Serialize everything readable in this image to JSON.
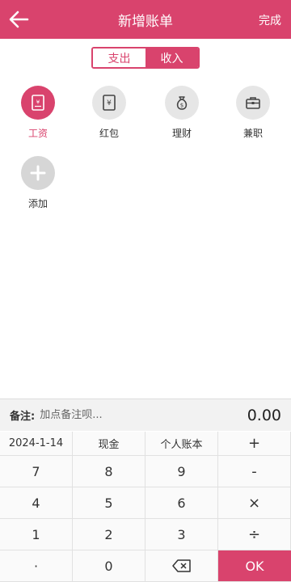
{
  "header": {
    "title": "新增账单",
    "done_label": "完成",
    "bg_color": "#d9436d"
  },
  "type_toggle": {
    "options": [
      {
        "label": "支出",
        "active": false
      },
      {
        "label": "收入",
        "active": true
      }
    ]
  },
  "categories": [
    {
      "label": "工资",
      "icon": "salary-receipt-icon",
      "selected": true
    },
    {
      "label": "红包",
      "icon": "red-envelope-icon",
      "selected": false
    },
    {
      "label": "理财",
      "icon": "money-bag-icon",
      "selected": false
    },
    {
      "label": "兼职",
      "icon": "briefcase-icon",
      "selected": false
    },
    {
      "label": "添加",
      "icon": "plus-icon",
      "selected": false
    }
  ],
  "note": {
    "label": "备注:",
    "placeholder": "加点备注呗...",
    "amount": "0.00"
  },
  "keypad": {
    "date": "2024-1-14",
    "account": "现金",
    "book": "个人账本",
    "plus": "+",
    "minus": "-",
    "multiply": "×",
    "divide": "÷",
    "dot": "·",
    "ok": "OK",
    "digits": [
      "7",
      "8",
      "9",
      "4",
      "5",
      "6",
      "1",
      "2",
      "3",
      "0"
    ]
  }
}
